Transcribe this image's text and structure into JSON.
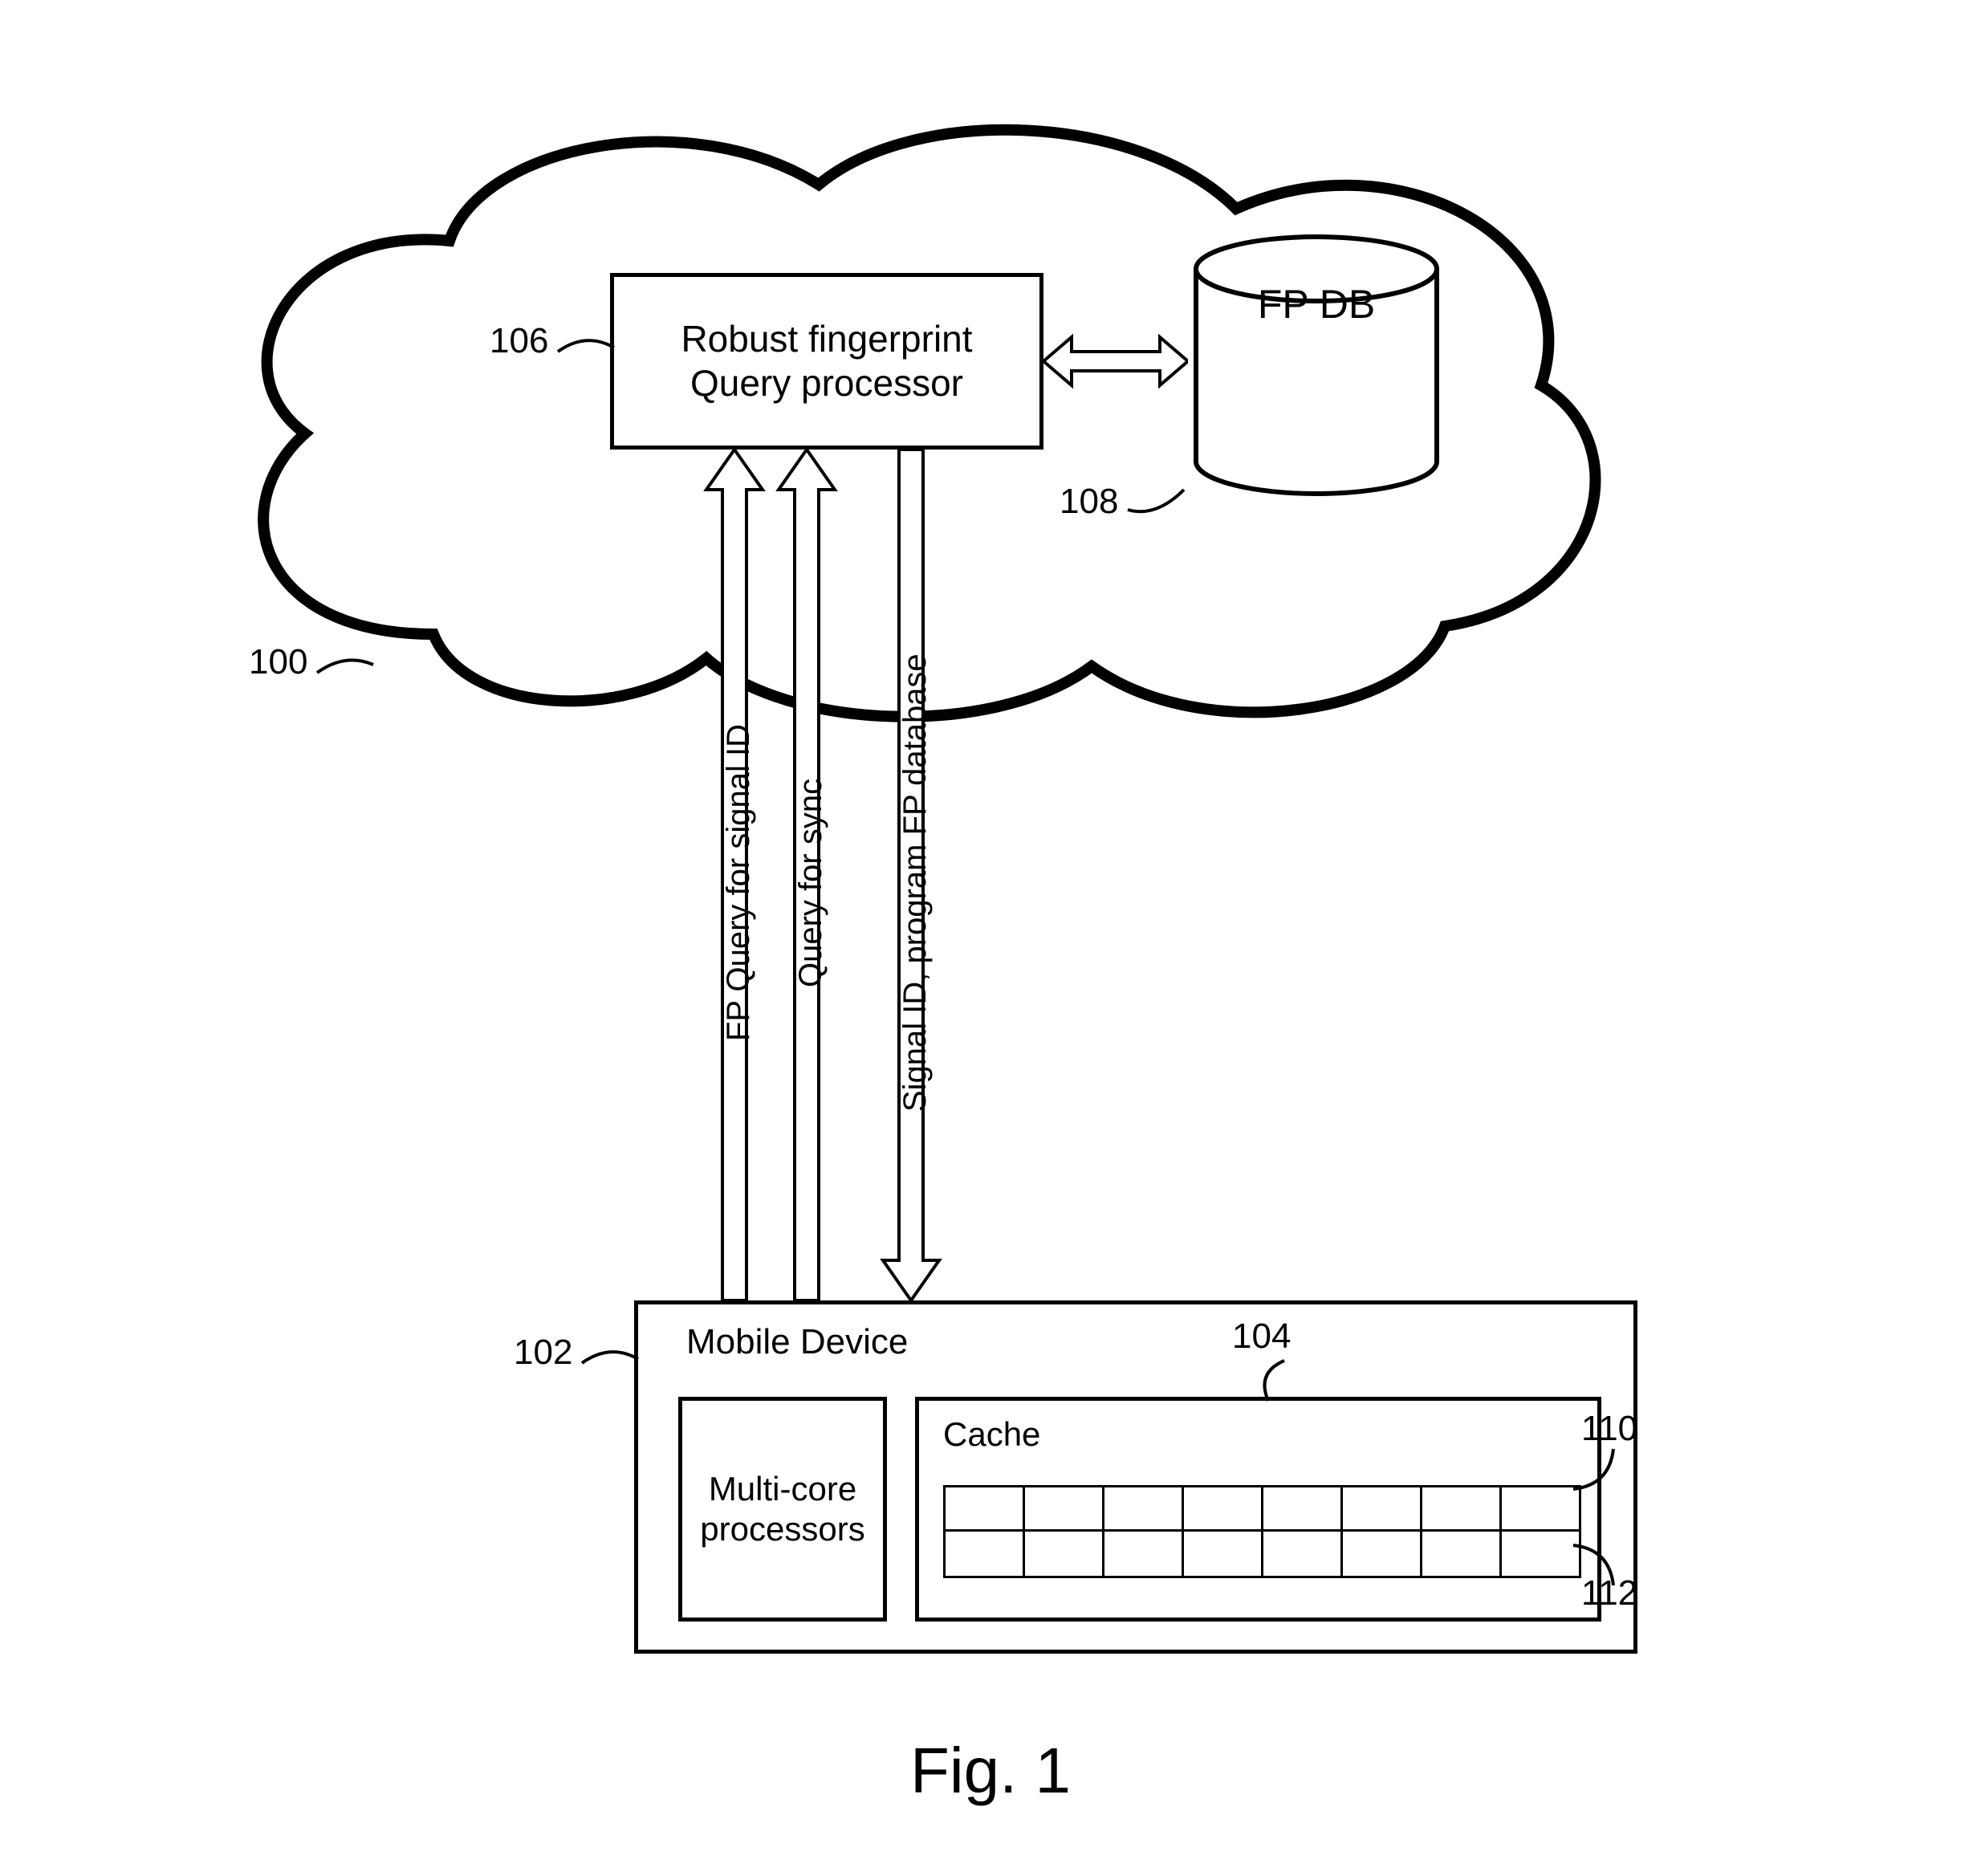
{
  "figure_caption": "Fig. 1",
  "cloud": {
    "ref": "100",
    "query_processor": {
      "ref": "106",
      "label": "Robust fingerprint\nQuery processor"
    },
    "fp_db": {
      "ref": "108",
      "label": "FP DB"
    }
  },
  "arrows": {
    "fp_query": "FP Query for signal ID",
    "query_sync": "Query for sync",
    "signal_id": "Signal ID, program FP database"
  },
  "mobile": {
    "ref": "102",
    "title": "Mobile Device",
    "multicore": "Multi-core\nprocessors",
    "cache": {
      "ref": "104",
      "title": "Cache",
      "row_top_ref": "110",
      "row_bottom_ref": "112",
      "cells_per_row": 8
    }
  }
}
